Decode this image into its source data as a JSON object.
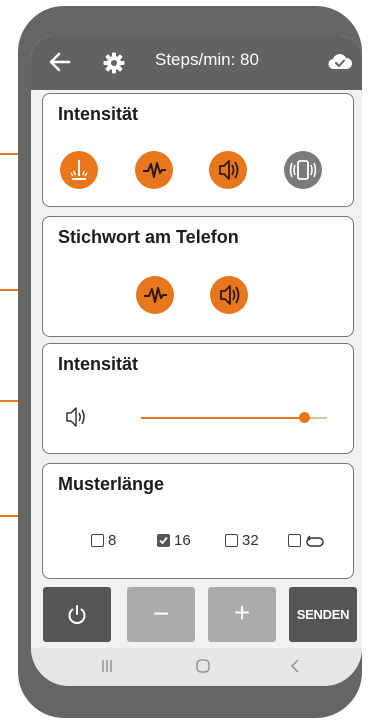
{
  "header": {
    "title": "Steps/min: 80",
    "icons": [
      "back-arrow-icon",
      "gear-icon",
      "cloud-check-icon"
    ]
  },
  "cards": {
    "intensity_mode": {
      "title": "Intensität",
      "buttons": [
        "vibration-pulse-icon",
        "waveform-icon",
        "speaker-icon",
        "phone-vibrate-icon"
      ]
    },
    "cue_on_phone": {
      "title": "Stichwort am Telefon",
      "buttons": [
        "waveform-icon",
        "speaker-icon"
      ]
    },
    "intensity_level": {
      "title": "Intensität",
      "icon": "speaker-icon",
      "slider_value_fraction": 0.88
    },
    "pattern_length": {
      "title": "Musterlänge",
      "options": [
        {
          "label": "8",
          "checked": false
        },
        {
          "label": "16",
          "checked": true
        },
        {
          "label": "32",
          "checked": false
        },
        {
          "label": "",
          "icon": "loop-icon",
          "checked": false
        }
      ]
    }
  },
  "bottom_buttons": {
    "power_icon": "power-icon",
    "minus_label": "−",
    "plus_label": "+",
    "send_label": "SENDEN"
  },
  "nav": [
    "recent-apps-icon",
    "home-icon",
    "back-icon"
  ],
  "colors": {
    "accent": "#e8761d",
    "header": "#626262",
    "disabled": "#7a7a7a"
  }
}
